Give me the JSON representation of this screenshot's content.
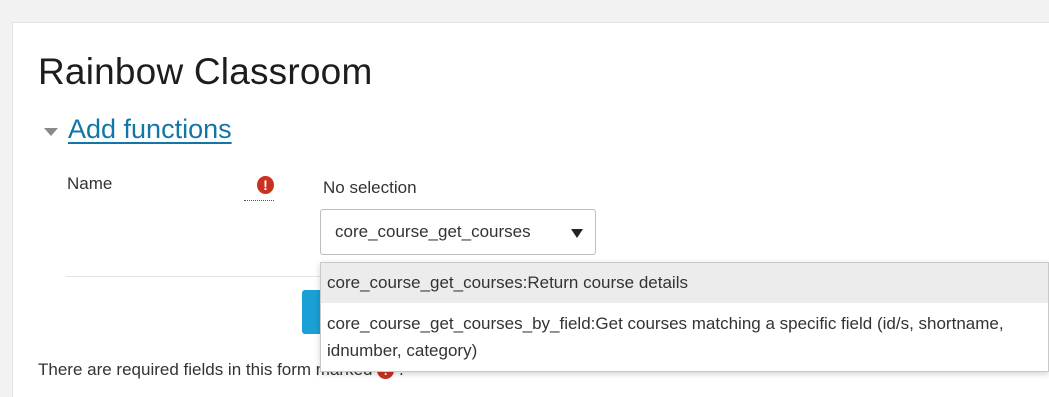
{
  "page": {
    "title": "Rainbow Classroom"
  },
  "section": {
    "label": "Add functions"
  },
  "form": {
    "name_label": "Name",
    "required_icon": "exclamation-icon",
    "selection_status": "No selection",
    "select_value": "core_course_get_courses",
    "required_note_prefix": "There are required fields in this form marked",
    "required_note_suffix": "."
  },
  "dropdown": {
    "options": [
      {
        "label": "core_course_get_courses:Return course details",
        "highlighted": true
      },
      {
        "label": "core_course_get_courses_by_field:Get courses matching a specific field (id/s, shortname, idnumber, category)",
        "highlighted": false
      }
    ]
  },
  "colors": {
    "link": "#1177a6",
    "required": "#ca3120",
    "button": "#1aa0d6",
    "highlight": "#ececec"
  }
}
